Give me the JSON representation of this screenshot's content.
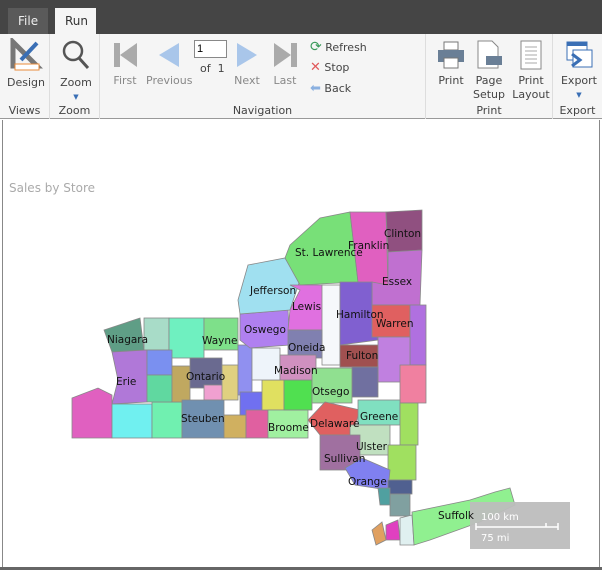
{
  "tabs": [
    {
      "label": "File"
    },
    {
      "label": "Run"
    }
  ],
  "ribbon": {
    "views": {
      "group": "Views",
      "design": "Design"
    },
    "zoom": {
      "group": "Zoom",
      "zoom": "Zoom"
    },
    "navigation": {
      "group": "Navigation",
      "first": "First",
      "previous": "Previous",
      "page": "1",
      "of": "of",
      "total": "1",
      "next": "Next",
      "last": "Last",
      "refresh": "Refresh",
      "stop": "Stop",
      "back": "Back"
    },
    "print": {
      "group": "Print",
      "print": "Print",
      "page_setup_1": "Page",
      "page_setup_2": "Setup",
      "print_layout_1": "Print",
      "print_layout_2": "Layout"
    },
    "export": {
      "group": "Export",
      "export": "Export"
    }
  },
  "report": {
    "title": "Sales by Store"
  },
  "map": {
    "labels": {
      "niagara": "Niagara",
      "wayne": "Wayne",
      "erie": "Erie",
      "ontario": "Ontario",
      "steuben": "Steuben",
      "oswego": "Oswego",
      "jefferson": "Jefferson",
      "st_lawrence": "St. Lawrence",
      "franklin": "Franklin",
      "clinton": "Clinton",
      "essex": "Essex",
      "lewis": "Lewis",
      "hamilton": "Hamilton",
      "warren": "Warren",
      "oneida": "Oneida",
      "fulton": "Fulton",
      "madison": "Madison",
      "otsego": "Otsego",
      "delaware": "Delaware",
      "greene": "Greene",
      "ulster": "Ulster",
      "sullivan": "Sullivan",
      "orange": "Orange",
      "broome": "Broome",
      "suffolk": "Suffolk"
    },
    "scale": {
      "km": "100 km",
      "mi": "75 mi"
    }
  }
}
